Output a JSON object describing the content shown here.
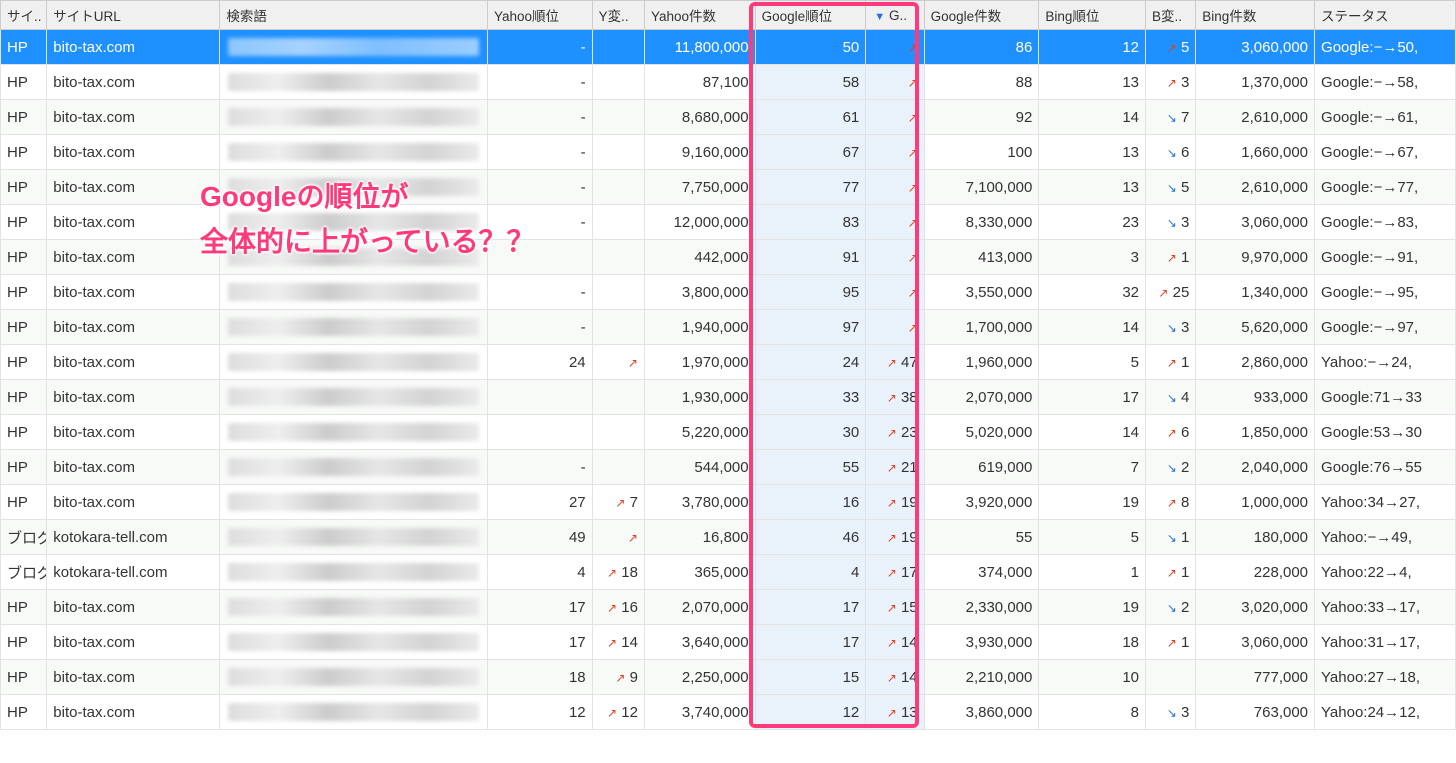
{
  "headers": {
    "site": "サイ..",
    "url": "サイトURL",
    "keyword": "検索語",
    "yrank": "Yahoo順位",
    "ychg": "Y変..",
    "ycnt": "Yahoo件数",
    "grank": "Google順位",
    "gchg": "G..",
    "gcnt": "Google件数",
    "brank": "Bing順位",
    "bchg": "B変..",
    "bcnt": "Bing件数",
    "status": "ステータス"
  },
  "annotation": {
    "line1": "Googleの順位が",
    "line2": "全体的に上がっている？？"
  },
  "rows": [
    {
      "sel": true,
      "site": "HP",
      "url": "bito-tax.com",
      "yrank": "-",
      "ychg": "",
      "ycnt": "11,800,000",
      "grank": "50",
      "gdir": "up",
      "gchg": "",
      "gcnt": "86",
      "brank": "12",
      "bdir": "up",
      "bchg": "5",
      "bcnt": "3,060,000",
      "status": "Google:−→50,"
    },
    {
      "site": "HP",
      "url": "bito-tax.com",
      "yrank": "-",
      "ychg": "",
      "ycnt": "87,100",
      "grank": "58",
      "gdir": "up",
      "gchg": "",
      "gcnt": "88",
      "brank": "13",
      "bdir": "up",
      "bchg": "3",
      "bcnt": "1,370,000",
      "status": "Google:−→58,"
    },
    {
      "alt": true,
      "site": "HP",
      "url": "bito-tax.com",
      "yrank": "-",
      "ychg": "",
      "ycnt": "8,680,000",
      "grank": "61",
      "gdir": "up",
      "gchg": "",
      "gcnt": "92",
      "brank": "14",
      "bdir": "down",
      "bchg": "7",
      "bcnt": "2,610,000",
      "status": "Google:−→61,"
    },
    {
      "site": "HP",
      "url": "bito-tax.com",
      "yrank": "-",
      "ychg": "",
      "ycnt": "9,160,000",
      "grank": "67",
      "gdir": "up",
      "gchg": "",
      "gcnt": "100",
      "brank": "13",
      "bdir": "down",
      "bchg": "6",
      "bcnt": "1,660,000",
      "status": "Google:−→67,"
    },
    {
      "alt": true,
      "site": "HP",
      "url": "bito-tax.com",
      "yrank": "-",
      "ychg": "",
      "ycnt": "7,750,000",
      "grank": "77",
      "gdir": "up",
      "gchg": "",
      "gcnt": "7,100,000",
      "brank": "13",
      "bdir": "down",
      "bchg": "5",
      "bcnt": "2,610,000",
      "status": "Google:−→77,"
    },
    {
      "site": "HP",
      "url": "bito-tax.com",
      "yrank": "-",
      "ychg": "",
      "ycnt": "12,000,000",
      "grank": "83",
      "gdir": "up",
      "gchg": "",
      "gcnt": "8,330,000",
      "brank": "23",
      "bdir": "down",
      "bchg": "3",
      "bcnt": "3,060,000",
      "status": "Google:−→83,"
    },
    {
      "alt": true,
      "site": "HP",
      "url": "bito-tax.com",
      "yrank": "",
      "ychg": "",
      "ycnt": "442,000",
      "grank": "91",
      "gdir": "up",
      "gchg": "",
      "gcnt": "413,000",
      "brank": "3",
      "bdir": "up",
      "bchg": "1",
      "bcnt": "9,970,000",
      "status": "Google:−→91,"
    },
    {
      "site": "HP",
      "url": "bito-tax.com",
      "yrank": "-",
      "ychg": "",
      "ycnt": "3,800,000",
      "grank": "95",
      "gdir": "up",
      "gchg": "",
      "gcnt": "3,550,000",
      "brank": "32",
      "bdir": "up",
      "bchg": "25",
      "bcnt": "1,340,000",
      "status": "Google:−→95,"
    },
    {
      "alt": true,
      "site": "HP",
      "url": "bito-tax.com",
      "yrank": "-",
      "ychg": "",
      "ycnt": "1,940,000",
      "grank": "97",
      "gdir": "up",
      "gchg": "",
      "gcnt": "1,700,000",
      "brank": "14",
      "bdir": "down",
      "bchg": "3",
      "bcnt": "5,620,000",
      "status": "Google:−→97,"
    },
    {
      "site": "HP",
      "url": "bito-tax.com",
      "yrank": "24",
      "ydir": "up",
      "ychg": "",
      "ycnt": "1,970,000",
      "grank": "24",
      "gdir": "up",
      "gchg": "47",
      "gcnt": "1,960,000",
      "brank": "5",
      "bdir": "up",
      "bchg": "1",
      "bcnt": "2,860,000",
      "status": "Yahoo:−→24, "
    },
    {
      "alt": true,
      "site": "HP",
      "url": "bito-tax.com",
      "yrank": "",
      "ychg": "",
      "ycnt": "1,930,000",
      "grank": "33",
      "gdir": "up",
      "gchg": "38",
      "gcnt": "2,070,000",
      "brank": "17",
      "bdir": "down",
      "bchg": "4",
      "bcnt": "933,000",
      "status": "Google:71→33"
    },
    {
      "site": "HP",
      "url": "bito-tax.com",
      "yrank": "",
      "ychg": "",
      "ycnt": "5,220,000",
      "grank": "30",
      "gdir": "up",
      "gchg": "23",
      "gcnt": "5,020,000",
      "brank": "14",
      "bdir": "up",
      "bchg": "6",
      "bcnt": "1,850,000",
      "status": "Google:53→30"
    },
    {
      "alt": true,
      "site": "HP",
      "url": "bito-tax.com",
      "yrank": "-",
      "ychg": "",
      "ycnt": "544,000",
      "grank": "55",
      "gdir": "up",
      "gchg": "21",
      "gcnt": "619,000",
      "brank": "7",
      "bdir": "down",
      "bchg": "2",
      "bcnt": "2,040,000",
      "status": "Google:76→55"
    },
    {
      "site": "HP",
      "url": "bito-tax.com",
      "yrank": "27",
      "ydir": "up",
      "ychg": "7",
      "ycnt": "3,780,000",
      "grank": "16",
      "gdir": "up",
      "gchg": "19",
      "gcnt": "3,920,000",
      "brank": "19",
      "bdir": "up",
      "bchg": "8",
      "bcnt": "1,000,000",
      "status": "Yahoo:34→27,"
    },
    {
      "alt": true,
      "site": "ブログ",
      "url": "kotokara-tell.com",
      "yrank": "49",
      "ydir": "up",
      "ychg": "",
      "ycnt": "16,800",
      "grank": "46",
      "gdir": "up",
      "gchg": "19",
      "gcnt": "55",
      "brank": "5",
      "bdir": "down",
      "bchg": "1",
      "bcnt": "180,000",
      "status": "Yahoo:−→49, "
    },
    {
      "site": "ブログ",
      "url": "kotokara-tell.com",
      "yrank": "4",
      "ydir": "up",
      "ychg": "18",
      "ycnt": "365,000",
      "grank": "4",
      "gdir": "up",
      "gchg": "17",
      "gcnt": "374,000",
      "brank": "1",
      "bdir": "up",
      "bchg": "1",
      "bcnt": "228,000",
      "status": "Yahoo:22→4, "
    },
    {
      "alt": true,
      "site": "HP",
      "url": "bito-tax.com",
      "yrank": "17",
      "ydir": "up",
      "ychg": "16",
      "ycnt": "2,070,000",
      "grank": "17",
      "gdir": "up",
      "gchg": "15",
      "gcnt": "2,330,000",
      "brank": "19",
      "bdir": "down",
      "bchg": "2",
      "bcnt": "3,020,000",
      "status": "Yahoo:33→17,"
    },
    {
      "site": "HP",
      "url": "bito-tax.com",
      "yrank": "17",
      "ydir": "up",
      "ychg": "14",
      "ycnt": "3,640,000",
      "grank": "17",
      "gdir": "up",
      "gchg": "14",
      "gcnt": "3,930,000",
      "brank": "18",
      "bdir": "up",
      "bchg": "1",
      "bcnt": "3,060,000",
      "status": "Yahoo:31→17,"
    },
    {
      "alt": true,
      "site": "HP",
      "url": "bito-tax.com",
      "yrank": "18",
      "ydir": "up",
      "ychg": "9",
      "ycnt": "2,250,000",
      "grank": "15",
      "gdir": "up",
      "gchg": "14",
      "gcnt": "2,210,000",
      "brank": "10",
      "bdir": "",
      "bchg": "",
      "bcnt": "777,000",
      "status": "Yahoo:27→18,"
    },
    {
      "site": "HP",
      "url": "bito-tax.com",
      "yrank": "12",
      "ydir": "up",
      "ychg": "12",
      "ycnt": "3,740,000",
      "grank": "12",
      "gdir": "up",
      "gchg": "13",
      "gcnt": "3,860,000",
      "brank": "8",
      "bdir": "down",
      "bchg": "3",
      "bcnt": "763,000",
      "status": "Yahoo:24→12,"
    }
  ]
}
